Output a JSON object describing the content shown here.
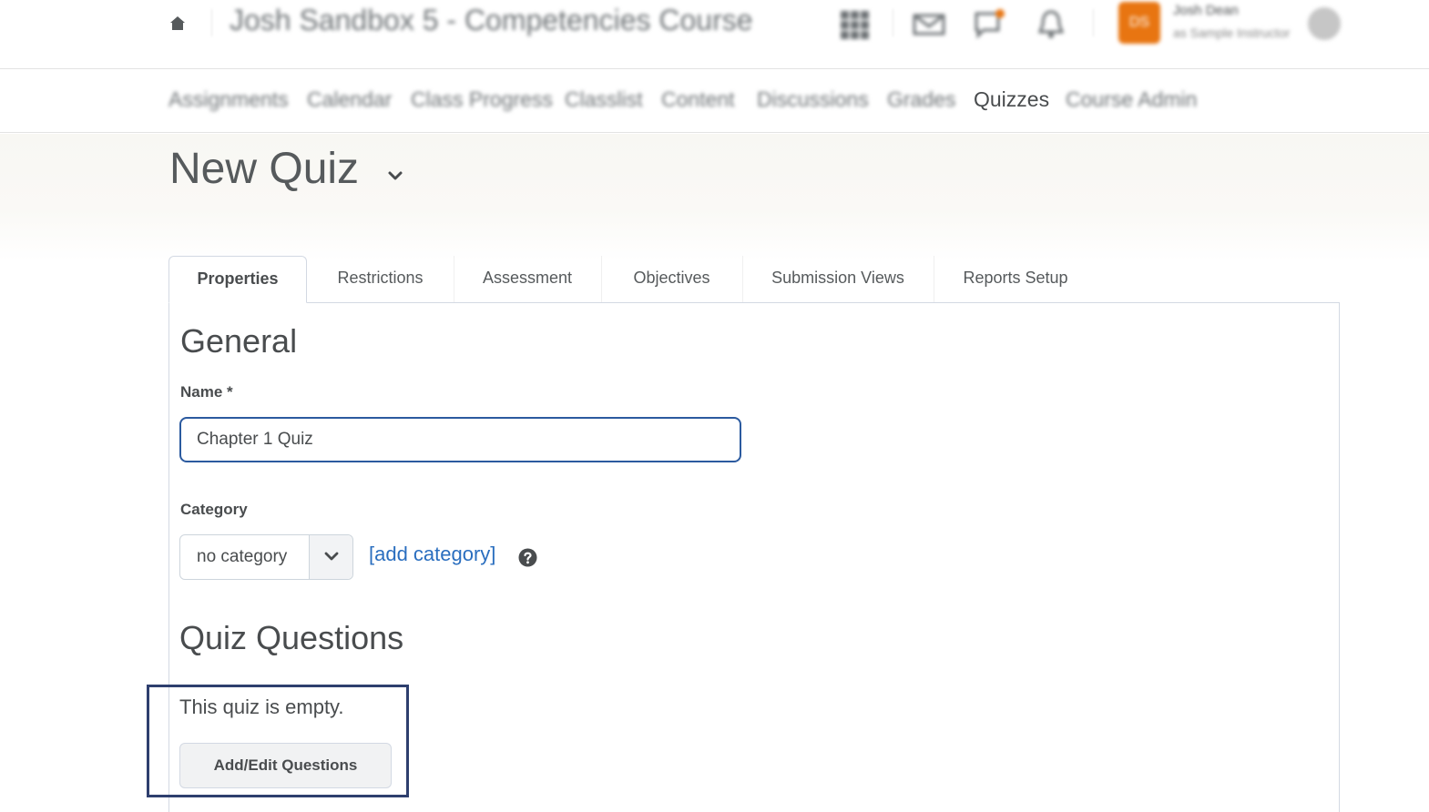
{
  "minibar": {
    "home_icon": "home-icon",
    "course_title": "Josh Sandbox 5 - Competencies Course",
    "icons": [
      "grid-icon",
      "mail-icon",
      "chat-icon",
      "bell-icon"
    ],
    "avatar_initials": "DS",
    "user_name": "Josh Dean",
    "user_role": "as Sample Instructor",
    "accent_color": "#e87511"
  },
  "navbar": {
    "items": [
      "Assignments",
      "Calendar",
      "Class Progress",
      "Classlist",
      "Content",
      "Discussions",
      "Grades",
      "Quizzes",
      "Course Admin"
    ],
    "active": "Quizzes"
  },
  "page": {
    "title": "New Quiz"
  },
  "tabs": [
    "Properties",
    "Restrictions",
    "Assessment",
    "Objectives",
    "Submission Views",
    "Reports Setup"
  ],
  "general": {
    "heading": "General",
    "name_label": "Name *",
    "name_value": "Chapter 1 Quiz",
    "category_label": "Category",
    "category_value": "no category",
    "add_category_link": "[add category]",
    "help_icon": "help-icon"
  },
  "quiz_questions": {
    "heading": "Quiz Questions",
    "empty_text": "This quiz is empty.",
    "add_edit_button": "Add/Edit Questions"
  },
  "colors": {
    "link": "#2a6ebf",
    "input_focus_border": "#2b5a9f",
    "highlight_border": "#2e3f6e"
  }
}
